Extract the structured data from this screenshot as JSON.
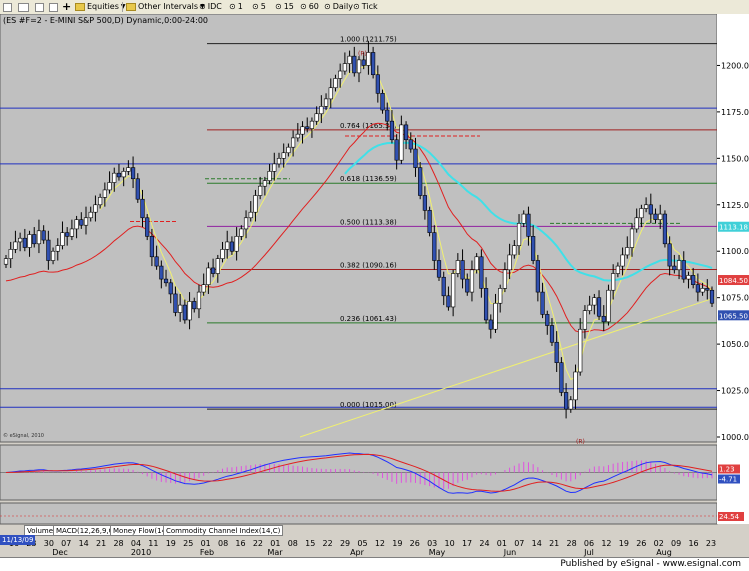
{
  "toolbar": {
    "symbol": "ES #F",
    "equities": "Equities",
    "other_intervals": "Other Intervals",
    "idc": "IDC",
    "i1": "1",
    "i5": "5",
    "i15": "15",
    "i60": "60",
    "daily": "Daily",
    "tick": "Tick"
  },
  "chart_title": "(ES #F=2 - E-MINI S&P 500,D) Dynamic,0:00-24:00",
  "copyright": "© eSignal, 2010",
  "tabs": [
    "Volume",
    "MACD(12,26,9,C)",
    "Money Flow(14)",
    "Commodity Channel Index(14,C)"
  ],
  "date_badge": "11/13/09",
  "status": "Published by eSignal - www.esignal.com",
  "colors": {
    "background": "#c0c0c0",
    "candle_up": "#ffffff",
    "candle_down": "#3050b0",
    "ma_red": "#e02020",
    "ma_cyan": "#40e0e8",
    "ma_yellow": "#f0f070",
    "fib_green": "#2a7a2a",
    "fib_purple": "#9020a0",
    "fib_red": "#a02020",
    "support_blue": "#2030c0"
  },
  "chart_data": {
    "type": "candlestick",
    "title": "(ES #F=2 - E-MINI S&P 500,D) Dynamic,0:00-24:00",
    "ylim": [
      1000,
      1225
    ],
    "y_ticks": [
      1000,
      1025,
      1050,
      1075,
      1100,
      1125,
      1150,
      1175,
      1200
    ],
    "x_tick_labels": [
      "16",
      "23",
      "30",
      "07",
      "14",
      "21",
      "28",
      "04",
      "11",
      "19",
      "25",
      "01",
      "08",
      "16",
      "22",
      "01",
      "08",
      "15",
      "22",
      "29",
      "05",
      "12",
      "19",
      "26",
      "03",
      "10",
      "17",
      "24",
      "01",
      "07",
      "14",
      "21",
      "28",
      "06",
      "12",
      "19",
      "26",
      "02",
      "09",
      "16",
      "23"
    ],
    "x_month_labels": [
      {
        "label": "Dec",
        "at": "07"
      },
      {
        "label": "2010",
        "at": "04"
      },
      {
        "label": "Feb",
        "at": "01"
      },
      {
        "label": "Mar",
        "at": "01"
      },
      {
        "label": "Apr",
        "at": "29"
      },
      {
        "label": "May",
        "at": "03"
      },
      {
        "label": "Jun",
        "at": "01"
      },
      {
        "label": "Jul",
        "at": "28"
      },
      {
        "label": "Aug",
        "at": "02"
      }
    ],
    "fib_levels": [
      {
        "label": "1.000 (1211.75)",
        "value": 1211.75,
        "color": "#202020"
      },
      {
        "label": "0.764 (1165.32)",
        "value": 1165.32,
        "color": "#a02020"
      },
      {
        "label": "0.618 (1136.59)",
        "value": 1136.59,
        "color": "#2a7a2a"
      },
      {
        "label": "0.500 (1113.38)",
        "value": 1113.38,
        "color": "#9020a0"
      },
      {
        "label": "0.382 (1090.16)",
        "value": 1090.16,
        "color": "#a02020"
      },
      {
        "label": "0.236 (1061.43)",
        "value": 1061.43,
        "color": "#2a7a2a"
      },
      {
        "label": "0.000 (1015.00)",
        "value": 1015.0,
        "color": "#202020"
      }
    ],
    "horizontal_lines": [
      {
        "value": 1177,
        "color": "#2030c0"
      },
      {
        "value": 1147,
        "color": "#2030c0"
      },
      {
        "value": 1026,
        "color": "#2030c0"
      },
      {
        "value": 1016,
        "color": "#2030c0"
      }
    ],
    "price_markers": [
      {
        "label": "1113.18",
        "value": 1113.18,
        "color": "#40d0d8"
      },
      {
        "label": "1084.50",
        "value": 1084.5,
        "color": "#e04040"
      },
      {
        "label": "1065.50",
        "value": 1065.5,
        "color": "#3050b0"
      }
    ],
    "annotations": [
      {
        "text": "(R)",
        "value": 1207
      },
      {
        "text": "(R)",
        "value": 998
      }
    ],
    "closes": [
      1096,
      1101,
      1105,
      1107,
      1102,
      1109,
      1104,
      1111,
      1106,
      1095,
      1100,
      1103,
      1110,
      1108,
      1112,
      1117,
      1114,
      1118,
      1121,
      1125,
      1129,
      1133,
      1137,
      1142,
      1140,
      1143,
      1145,
      1139,
      1128,
      1118,
      1108,
      1097,
      1092,
      1085,
      1083,
      1077,
      1067,
      1071,
      1063,
      1073,
      1069,
      1078,
      1082,
      1091,
      1088,
      1096,
      1101,
      1105,
      1100,
      1108,
      1112,
      1118,
      1121,
      1130,
      1135,
      1138,
      1143,
      1147,
      1150,
      1153,
      1156,
      1161,
      1163,
      1167,
      1166,
      1170,
      1174,
      1178,
      1182,
      1188,
      1193,
      1197,
      1201,
      1205,
      1196,
      1203,
      1200,
      1207,
      1195,
      1185,
      1176,
      1170,
      1160,
      1149,
      1168,
      1160,
      1155,
      1145,
      1130,
      1122,
      1110,
      1095,
      1086,
      1076,
      1070,
      1088,
      1095,
      1085,
      1078,
      1090,
      1097,
      1080,
      1063,
      1058,
      1072,
      1080,
      1090,
      1098,
      1103,
      1115,
      1120,
      1108,
      1095,
      1078,
      1066,
      1060,
      1051,
      1040,
      1024,
      1015,
      1020,
      1035,
      1058,
      1068,
      1071,
      1075,
      1065,
      1062,
      1079,
      1088,
      1092,
      1098,
      1102,
      1112,
      1118,
      1123,
      1125,
      1120,
      1117,
      1120,
      1104,
      1092,
      1090,
      1095,
      1085,
      1087,
      1082,
      1078,
      1080,
      1079,
      1072
    ],
    "macd_series": [
      {
        "name": "MACD",
        "color": "#2030ff"
      },
      {
        "name": "Signal",
        "color": "#e02020"
      }
    ],
    "macd_markers": [
      {
        "label": "1.23",
        "color": "#e04040"
      },
      {
        "label": "-4.71",
        "color": "#3050c0"
      }
    ],
    "indicator_marker": {
      "label": "24.54",
      "color": "#e04040"
    }
  }
}
